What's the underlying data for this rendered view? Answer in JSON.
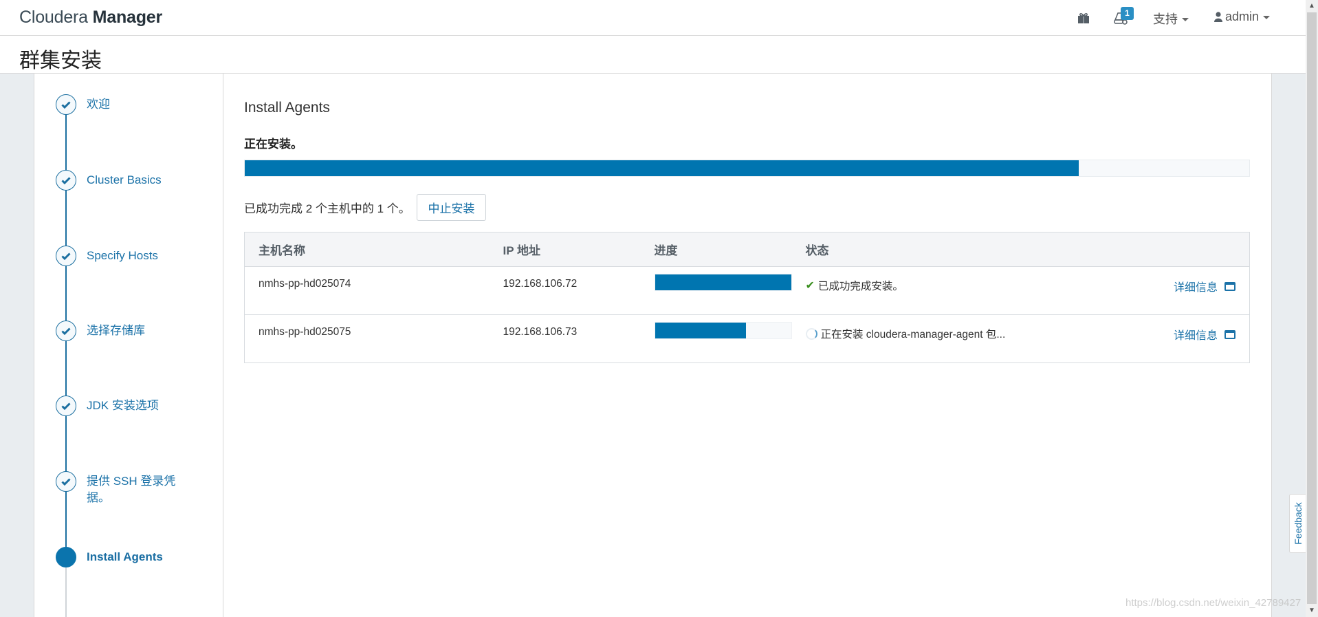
{
  "header": {
    "logo_light": "Cloudera",
    "logo_bold": "Manager",
    "gift_icon": "gift-icon",
    "alerts_icon": "alerts-icon",
    "alerts_count": "1",
    "support_label": "支持",
    "user_icon": "user-icon",
    "user_label": "admin"
  },
  "page": {
    "title": "群集安装"
  },
  "wizard": {
    "steps": [
      {
        "label": "欢迎",
        "state": "done"
      },
      {
        "label": "Cluster Basics",
        "state": "done"
      },
      {
        "label": "Specify Hosts",
        "state": "done"
      },
      {
        "label": "选择存储库",
        "state": "done"
      },
      {
        "label": "JDK 安装选项",
        "state": "done"
      },
      {
        "label": "提供 SSH 登录凭据。",
        "state": "done"
      },
      {
        "label": "Install Agents",
        "state": "active"
      }
    ]
  },
  "main": {
    "section_title": "Install Agents",
    "status_heading": "正在安装。",
    "overall_progress": 0.83,
    "count_text": "已成功完成 2 个主机中的 1 个。",
    "abort_label": "中止安装",
    "table": {
      "headers": [
        "主机名称",
        "IP 地址",
        "进度",
        "状态",
        ""
      ],
      "rows": [
        {
          "hostname": "nmhs-pp-hd025074",
          "ip": "192.168.106.72",
          "progress": 1.0,
          "status_icon": "check-icon",
          "status": "已成功完成安装。",
          "details_label": "详细信息"
        },
        {
          "hostname": "nmhs-pp-hd025075",
          "ip": "192.168.106.73",
          "progress": 0.67,
          "status_icon": "spinner-icon",
          "status": "正在安装 cloudera-manager-agent 包...",
          "details_label": "详细信息"
        }
      ]
    }
  },
  "feedback_label": "Feedback",
  "watermark": "https://blog.csdn.net/weixin_42789427",
  "colors": {
    "accent": "#0075b0",
    "link": "#1b72a8",
    "success": "#3a8f1f",
    "badge": "#2a8fc4"
  }
}
